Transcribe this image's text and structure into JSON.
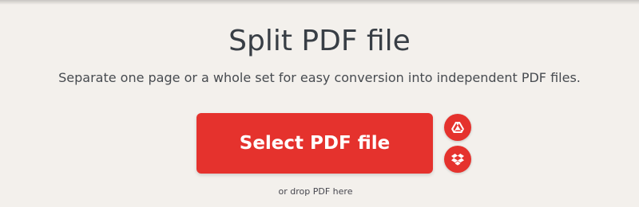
{
  "header": {
    "title": "Split PDF file",
    "subtitle": "Separate one page or a whole set for easy conversion into independent PDF files."
  },
  "upload": {
    "select_button_label": "Select PDF file",
    "drop_hint": "or drop PDF here",
    "cloud_sources": [
      {
        "name": "Google Drive",
        "icon": "google-drive-icon"
      },
      {
        "name": "Dropbox",
        "icon": "dropbox-icon"
      }
    ]
  },
  "colors": {
    "background": "#f3f0ec",
    "accent": "#e5322d",
    "title_text": "#383e45"
  }
}
